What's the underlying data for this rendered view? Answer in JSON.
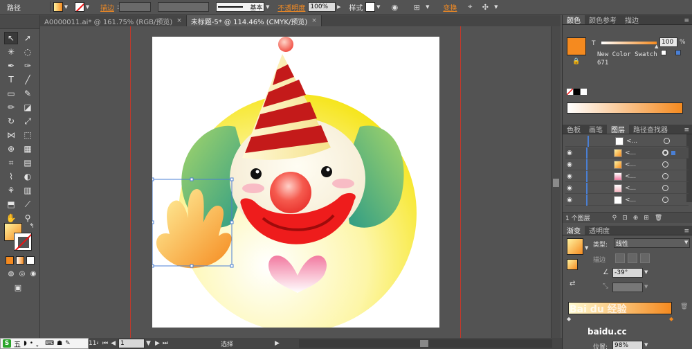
{
  "control_bar": {
    "label_path": "路径",
    "stroke_label": "描边",
    "stroke_value": ":",
    "brush_label": "基本",
    "opacity_label": "不透明度",
    "opacity_value": "100%",
    "style_label": "样式",
    "transform_label": "变换"
  },
  "tabs": [
    {
      "label": "A0000011.ai* @ 161.75% (RGB/预览)",
      "close": "×"
    },
    {
      "label": "未标题-5* @ 114.46% (CMYK/预览)",
      "close": "×"
    }
  ],
  "status": {
    "zoom": "114.46",
    "page": "1",
    "mode": "选择",
    "ime": [
      "五",
      "◗",
      "•",
      "。",
      "⌨",
      "☗",
      "✎"
    ]
  },
  "color_panel": {
    "tabs": [
      "颜色",
      "颜色参考",
      "描边"
    ],
    "t_label": "T",
    "t_value": "100",
    "t_unit": "%",
    "swatch_name": "New Color Swatch",
    "swatch_num": "671",
    "fill_color": "#f58a1f"
  },
  "layers_panel": {
    "tabs": [
      "色板",
      "画笔",
      "图层",
      "路径查找器"
    ],
    "rows": [
      "<...",
      "<...",
      "<...",
      "<...",
      "<...",
      "<..."
    ],
    "footer": "1 个图层"
  },
  "gradient_panel": {
    "tabs": [
      "渐变",
      "透明度"
    ],
    "type_label": "类型:",
    "type_value": "线性",
    "stroke_label": "描边",
    "angle_value": "-39°",
    "location_label": "位置:",
    "location_value": "98%",
    "watermark": "Bai du 经验",
    "watermark2": "baidu.cc"
  },
  "colors": {
    "accent_orange": "#f58a1f",
    "panel_bg": "#535353",
    "guide_red": "#c0392b"
  }
}
